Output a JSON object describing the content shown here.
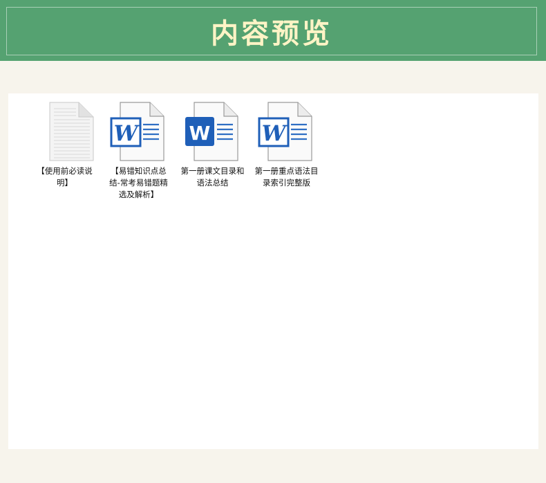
{
  "header": {
    "title": "内容预览"
  },
  "files": [
    {
      "name": "【使用前必读说明】",
      "icon": "text-document-icon"
    },
    {
      "name": "【易错知识点总结-常考易错题精选及解析】",
      "icon": "word-document-icon"
    },
    {
      "name": "第一册课文目录和语法总结",
      "icon": "word-document-icon"
    },
    {
      "name": "第一册重点语法目录索引完整版",
      "icon": "word-document-icon"
    }
  ],
  "colors": {
    "header_bg": "#55a271",
    "title": "#fff4c6",
    "page_bg": "#f7f4ec",
    "word_blue": "#1f5fb8"
  }
}
